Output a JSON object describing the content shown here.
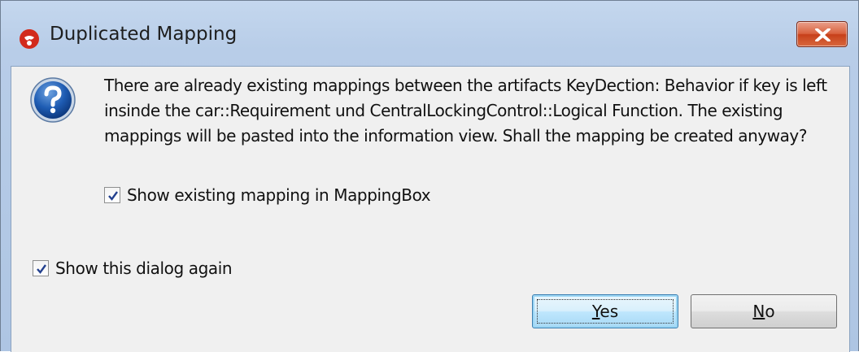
{
  "window": {
    "title": "Duplicated Mapping"
  },
  "message": "There are already existing mappings between the artifacts KeyDection: Behavior if key is left insinde the car::Requirement und CentralLockingControl::Logical Function. The existing mappings will be pasted into the information view. Shall the mapping be created anyway?",
  "checkboxes": {
    "show_in_mappingbox": {
      "label": "Show existing mapping in MappingBox",
      "checked": true
    },
    "show_dialog_again": {
      "label": "Show this dialog again",
      "checked": true
    }
  },
  "buttons": {
    "yes": {
      "mnemonic": "Y",
      "rest": "es"
    },
    "no": {
      "mnemonic": "N",
      "rest": "o"
    }
  },
  "colors": {
    "titlebar": "#b8cde8",
    "client_bg": "#f0f0f0",
    "close_red": "#c7401a",
    "default_button": "#bee6fd"
  },
  "icons": {
    "app": "app-logo-icon",
    "question": "question-icon",
    "close": "close-icon"
  }
}
